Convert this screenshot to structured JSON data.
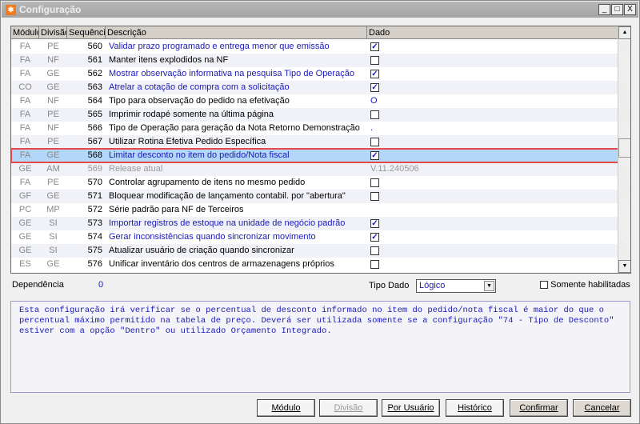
{
  "window": {
    "title": "Configuração",
    "controls": [
      "_",
      "□",
      "X"
    ]
  },
  "grid": {
    "columns": [
      "Módulo",
      "Divisão",
      "Sequência",
      "Descrição",
      "Dado"
    ],
    "rows": [
      {
        "modulo": "FA",
        "divisao": "PE",
        "seq": "560",
        "descricao": "Validar prazo programado e entrega menor que emissão",
        "dado": "checked",
        "blue": true
      },
      {
        "modulo": "FA",
        "divisao": "NF",
        "seq": "561",
        "descricao": "Manter itens explodidos na NF",
        "dado": "unchecked",
        "blue": false
      },
      {
        "modulo": "FA",
        "divisao": "GE",
        "seq": "562",
        "descricao": "Mostrar observação informativa na pesquisa Tipo de Operação",
        "dado": "checked",
        "blue": true
      },
      {
        "modulo": "CO",
        "divisao": "GE",
        "seq": "563",
        "descricao": "Atrelar a cotação de compra com a solicitação",
        "dado": "checked",
        "blue": true
      },
      {
        "modulo": "FA",
        "divisao": "NF",
        "seq": "564",
        "descricao": "Tipo para observação do pedido na efetivação",
        "dado": "O",
        "blue": false
      },
      {
        "modulo": "FA",
        "divisao": "PE",
        "seq": "565",
        "descricao": "Imprimir rodapé somente na última página",
        "dado": "unchecked",
        "blue": false
      },
      {
        "modulo": "FA",
        "divisao": "NF",
        "seq": "566",
        "descricao": "Tipo de Operação para geração da Nota Retorno Demonstração",
        "dado": " .",
        "blue": false
      },
      {
        "modulo": "FA",
        "divisao": "PE",
        "seq": "567",
        "descricao": "Utilizar Rotina Efetiva Pedido Específica",
        "dado": "unchecked",
        "blue": false
      },
      {
        "modulo": "FA",
        "divisao": "GE",
        "seq": "568",
        "descricao": "Limitar desconto no item do pedido/Nota fiscal",
        "dado": "checked",
        "blue": true,
        "selected": true
      },
      {
        "modulo": "GE",
        "divisao": "AM",
        "seq": "569",
        "descricao": "Release atual",
        "dado": "V.11.240506",
        "blue": false,
        "disabled": true
      },
      {
        "modulo": "FA",
        "divisao": "PE",
        "seq": "570",
        "descricao": "Controlar agrupamento de itens no mesmo pedido",
        "dado": "unchecked",
        "blue": false
      },
      {
        "modulo": "GF",
        "divisao": "GE",
        "seq": "571",
        "descricao": "Bloquear modificação de lançamento contabil. por \"abertura\"",
        "dado": "unchecked",
        "blue": false
      },
      {
        "modulo": "PC",
        "divisao": "MP",
        "seq": "572",
        "descricao": "Série padrão para NF de Terceiros",
        "dado": "",
        "blue": false
      },
      {
        "modulo": "GE",
        "divisao": "SI",
        "seq": "573",
        "descricao": "Importar registros de estoque na unidade de negócio padrão",
        "dado": "checked",
        "blue": true
      },
      {
        "modulo": "GE",
        "divisao": "SI",
        "seq": "574",
        "descricao": "Gerar inconsistências quando sincronizar movimento",
        "dado": "checked",
        "blue": true
      },
      {
        "modulo": "GE",
        "divisao": "SI",
        "seq": "575",
        "descricao": "Atualizar usuário de criação quando sincronizar",
        "dado": "unchecked",
        "blue": false
      },
      {
        "modulo": "ES",
        "divisao": "GE",
        "seq": "576",
        "descricao": "Unificar inventário dos centros de armazenagens próprios",
        "dado": "unchecked",
        "blue": false
      }
    ]
  },
  "footer": {
    "dependencia_label": "Dependência",
    "dependencia_value": "0",
    "tipo_dado_label": "Tipo Dado",
    "tipo_dado_value": "Lógico",
    "somente_label": "Somente habilitadas",
    "description": "Esta configuração irá verificar se o percentual de desconto informado no item do pedido/nota fiscal é maior do que o percentual máximo permitido na tabela de preço. Deverá ser utilizada somente se a configuração \"74 - Tipo de Desconto\" estiver com a opção \"Dentro\" ou utilizado Orçamento Integrado."
  },
  "buttons": {
    "modulo": "Módulo",
    "divisao": "Divisão",
    "por_usuario": "Por Usuário",
    "historico": "Histórico",
    "confirmar": "Confirmar",
    "cancelar": "Cancelar"
  },
  "colors": {
    "selection": "#b3d7f9",
    "highlight_border": "#e8484a",
    "blue_text": "#1a1ab8"
  }
}
